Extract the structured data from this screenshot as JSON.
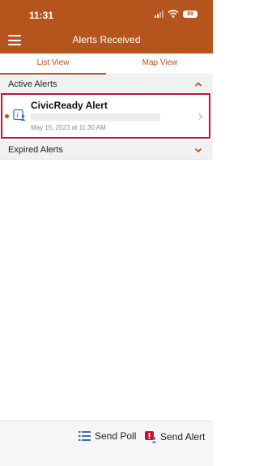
{
  "status_bar": {
    "time": "11:31",
    "battery": "89"
  },
  "header": {
    "title": "Alerts Received"
  },
  "tabs": [
    {
      "label": "List View",
      "active": true
    },
    {
      "label": "Map View",
      "active": false
    }
  ],
  "sections": {
    "active": {
      "label": "Active Alerts",
      "expanded": true
    },
    "expired": {
      "label": "Expired Alerts",
      "expanded": false
    }
  },
  "alerts": [
    {
      "title": "CivicReady Alert",
      "date": "May 15, 2023 at 11:30 AM",
      "unread": true
    }
  ],
  "footer": {
    "send_poll": "Send Poll",
    "send_alert": "Send Alert"
  },
  "colors": {
    "brand": "#b5541d",
    "highlight": "#c8102e",
    "icon_blue": "#3a6fb0"
  }
}
